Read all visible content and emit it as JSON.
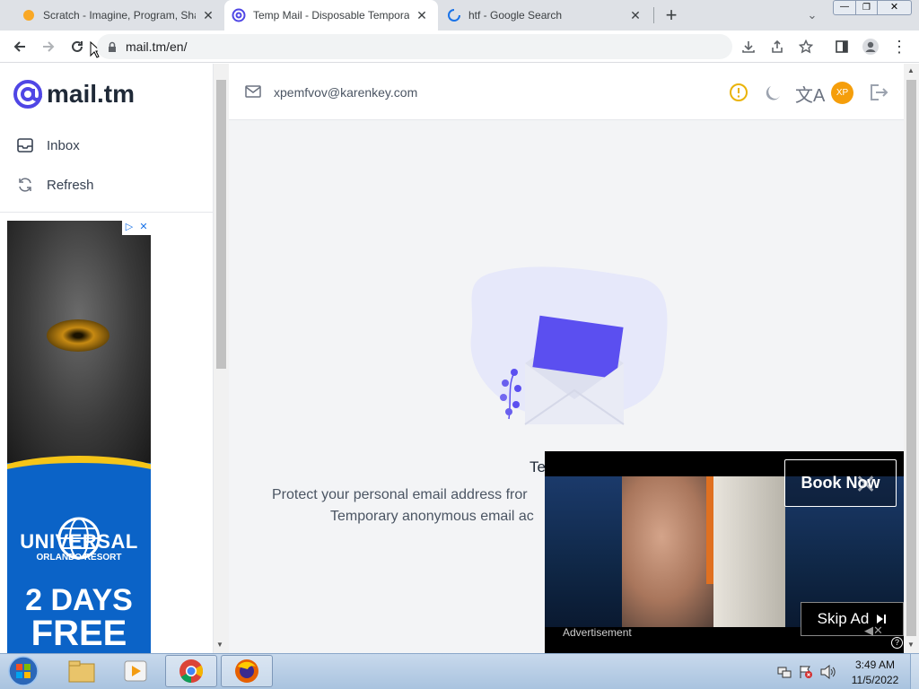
{
  "browser": {
    "tabs": [
      {
        "title": "Scratch - Imagine, Program, Shar",
        "active": false
      },
      {
        "title": "Temp Mail - Disposable Tempora",
        "active": true
      },
      {
        "title": "htf - Google Search",
        "active": false
      }
    ],
    "url": "mail.tm/en/"
  },
  "sidebar": {
    "logo_text": "mail.tm",
    "nav": [
      {
        "label": "Inbox",
        "icon": "inbox-icon"
      },
      {
        "label": "Refresh",
        "icon": "refresh-icon"
      }
    ]
  },
  "left_ad": {
    "brand": "UNIVERSAL",
    "sub": "ORLANDO RESORT",
    "headline1": "2 DAYS",
    "headline2": "FREE"
  },
  "header": {
    "email": "xpemfvov@karenkey.com",
    "xp_badge": "XP"
  },
  "main": {
    "heading": "Te",
    "line1": "Protect your personal email address fror",
    "line2": "Temporary anonymous email ac"
  },
  "video_ad": {
    "book_now": "Book Now",
    "skip": "Skip Ad",
    "label": "Advertisement"
  },
  "taskbar": {
    "time": "3:49 AM",
    "date": "11/5/2022"
  },
  "colors": {
    "accent": "#4f46e5",
    "xp_badge": "#f59e0b",
    "warning": "#eab308"
  }
}
